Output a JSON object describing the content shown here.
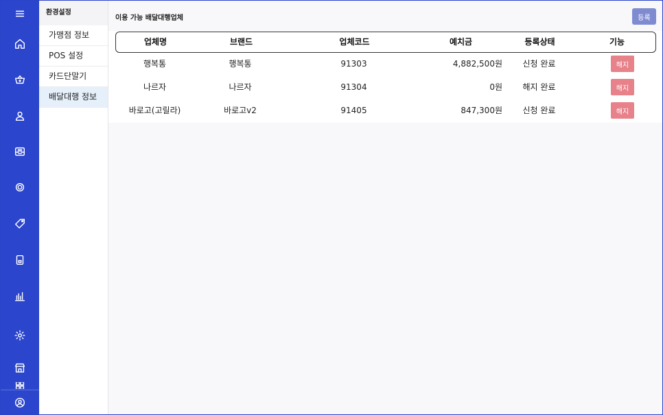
{
  "submenu": {
    "header": "환경설정",
    "items": [
      {
        "label": "가맹점 정보"
      },
      {
        "label": "POS 설정"
      },
      {
        "label": "카드단말기"
      },
      {
        "label": "배달대행 정보"
      }
    ]
  },
  "main": {
    "title": "이용 가능 배달대행업체",
    "register_label": "등록",
    "columns": [
      "업체명",
      "브랜드",
      "업체코드",
      "예치금",
      "등록상태",
      "기능"
    ],
    "rows": [
      {
        "company": "행복통",
        "brand": "행복통",
        "code": "91303",
        "deposit": "4,882,500원",
        "status": "신청 완료",
        "action": "해지"
      },
      {
        "company": "나르자",
        "brand": "나르자",
        "code": "91304",
        "deposit": "0원",
        "status": "해지 완료",
        "action": "해지"
      },
      {
        "company": "바로고(고릴라)",
        "brand": "바로고v2",
        "code": "91405",
        "deposit": "847,300원",
        "status": "신청 완료",
        "action": "해지"
      }
    ]
  },
  "rail_icons": [
    "menu-icon",
    "home-icon",
    "basket-icon",
    "user-icon",
    "inbox-icon",
    "target-icon",
    "tag-icon",
    "tablet-icon",
    "bar-chart-icon",
    "settings-icon",
    "store-icon",
    "grid-icon",
    "profile-icon"
  ],
  "colors": {
    "rail": "#2b45cc",
    "register_button": "#7f8bd1",
    "cancel_button": "#e7818a",
    "active_item": "#e6f0fb"
  }
}
